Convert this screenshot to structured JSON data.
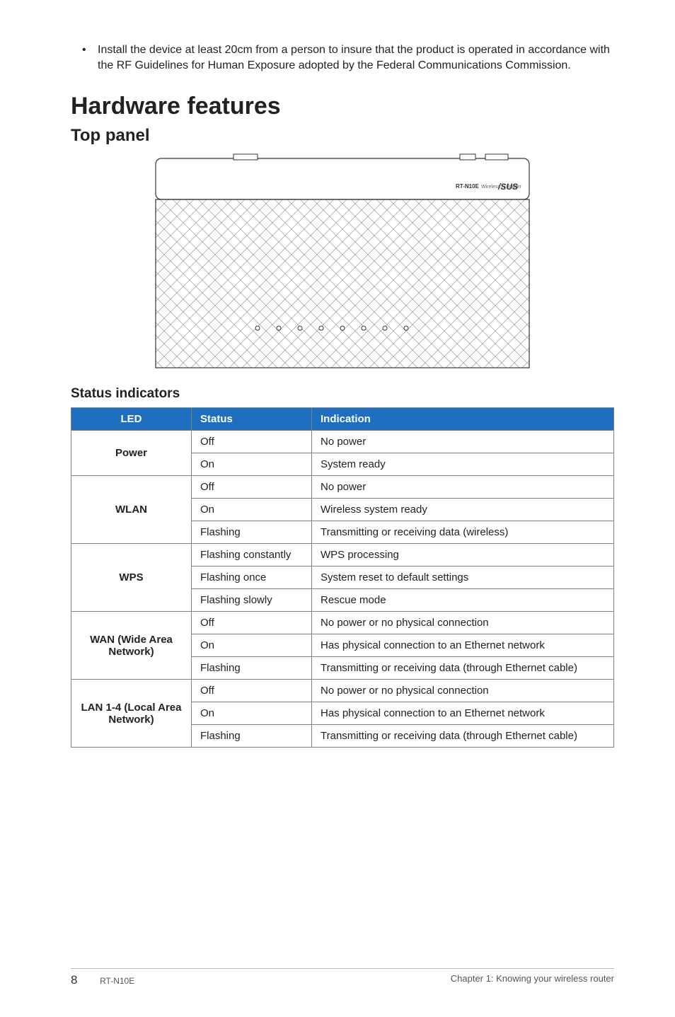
{
  "notice": {
    "bullet": "•",
    "text": "Install the device at least 20cm from a person to insure that the product is operated in accordance with the RF Guidelines for Human Exposure adopted by the Federal Communications Commission."
  },
  "headings": {
    "h1": "Hardware features",
    "h2": "Top panel",
    "h3": "Status indicators"
  },
  "device": {
    "label": "RT-N10E Wireless N Router",
    "brand": "ASUS"
  },
  "table": {
    "headers": {
      "led": "LED",
      "status": "Status",
      "indication": "Indication"
    },
    "groups": [
      {
        "name": "Power",
        "rows": [
          {
            "status": "Off",
            "indication": "No power"
          },
          {
            "status": "On",
            "indication": "System ready"
          }
        ]
      },
      {
        "name": "WLAN",
        "rows": [
          {
            "status": "Off",
            "indication": "No power"
          },
          {
            "status": "On",
            "indication": "Wireless system ready"
          },
          {
            "status": "Flashing",
            "indication": "Transmitting or receiving data (wireless)"
          }
        ]
      },
      {
        "name": "WPS",
        "rows": [
          {
            "status": "Flashing constantly",
            "indication": "WPS processing"
          },
          {
            "status": "Flashing once",
            "indication": "System reset to default settings"
          },
          {
            "status": "Flashing slowly",
            "indication": "Rescue mode"
          }
        ]
      },
      {
        "name": "WAN (Wide Area Network)",
        "rows": [
          {
            "status": "Off",
            "indication": "No power or no physical connection"
          },
          {
            "status": "On",
            "indication": "Has physical connection to an Ethernet network"
          },
          {
            "status": "Flashing",
            "indication": "Transmitting or receiving data (through Ethernet cable)"
          }
        ]
      },
      {
        "name": "LAN 1-4 (Local Area Network)",
        "rows": [
          {
            "status": "Off",
            "indication": "No power or no physical connection"
          },
          {
            "status": "On",
            "indication": "Has physical connection to an Ethernet network"
          },
          {
            "status": "Flashing",
            "indication": "Transmitting or receiving data (through Ethernet cable)"
          }
        ]
      }
    ]
  },
  "footer": {
    "page": "8",
    "model": "RT-N10E",
    "chapter": "Chapter 1: Knowing your wireless router"
  }
}
